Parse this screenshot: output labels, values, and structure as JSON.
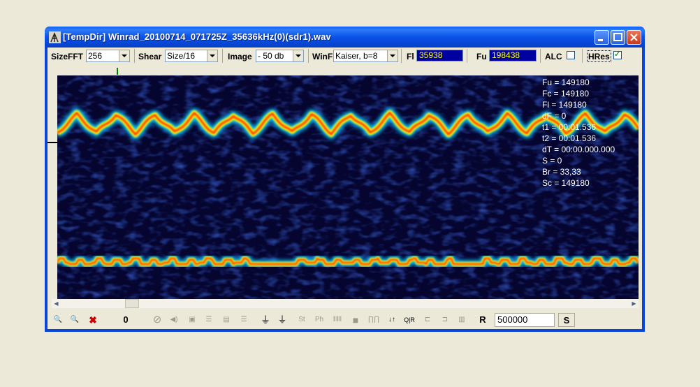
{
  "window": {
    "title": "[TempDir] Winrad_20100714_071725Z_35636kHz(0)(sdr1).wav",
    "app_icon": "antenna-icon",
    "controls": [
      "minimize-icon",
      "maximize-icon",
      "close-icon"
    ]
  },
  "toolbar": {
    "sizefft_label": "SizeFFT",
    "sizefft_value": "256",
    "shear_label": "Shear",
    "shear_value": "Size/16",
    "image_label": "Image",
    "image_value": "- 50 db",
    "winf_label": "WinF",
    "winf_value": "Kaiser, b=8",
    "fl_label": "Fl",
    "fl_value": "35938",
    "fu_label": "Fu",
    "fu_value": "198438",
    "alc_label": "ALC",
    "alc_checked": false,
    "hres_label": "HRes",
    "hres_checked": true
  },
  "info": {
    "fu": "Fu = 149180",
    "fc": "Fc = 149180",
    "fl": "Fl = 149180",
    "df": "dF = 0",
    "t1": "t1 = 00:01.536",
    "t2": "t2 = 00:01.536",
    "dt": "dT = 00:00.000.000",
    "s": "S = 0",
    "br": "Br = 33,33",
    "sc": "Sc = 149180"
  },
  "bottom_toolbar": {
    "counter": "0",
    "r_label": "R",
    "r_value": "500000",
    "s_label": "S",
    "icons": [
      "zoom-in-icon",
      "zoom-out-icon",
      "delete-icon",
      "clear-icon",
      "speaker-icon",
      "stop-icon",
      "filter-icon",
      "filter2-icon",
      "filter3-icon",
      "down-arrow-icon",
      "ant-icon",
      "st-icon",
      "ph-icon",
      "comb-icon",
      "block-icon",
      "pulse-icon",
      "sort-icon",
      "qr-icon",
      "shape1-icon",
      "shape2-icon",
      "export-icon"
    ]
  },
  "colors": {
    "waterfall_bg": "#0A0A3A",
    "signal_hot": "#FF3000",
    "signal_mid": "#FFFF00",
    "signal_cool": "#00C0FF",
    "value_bg": "#0000A0",
    "value_fg": "#FFFF00"
  }
}
